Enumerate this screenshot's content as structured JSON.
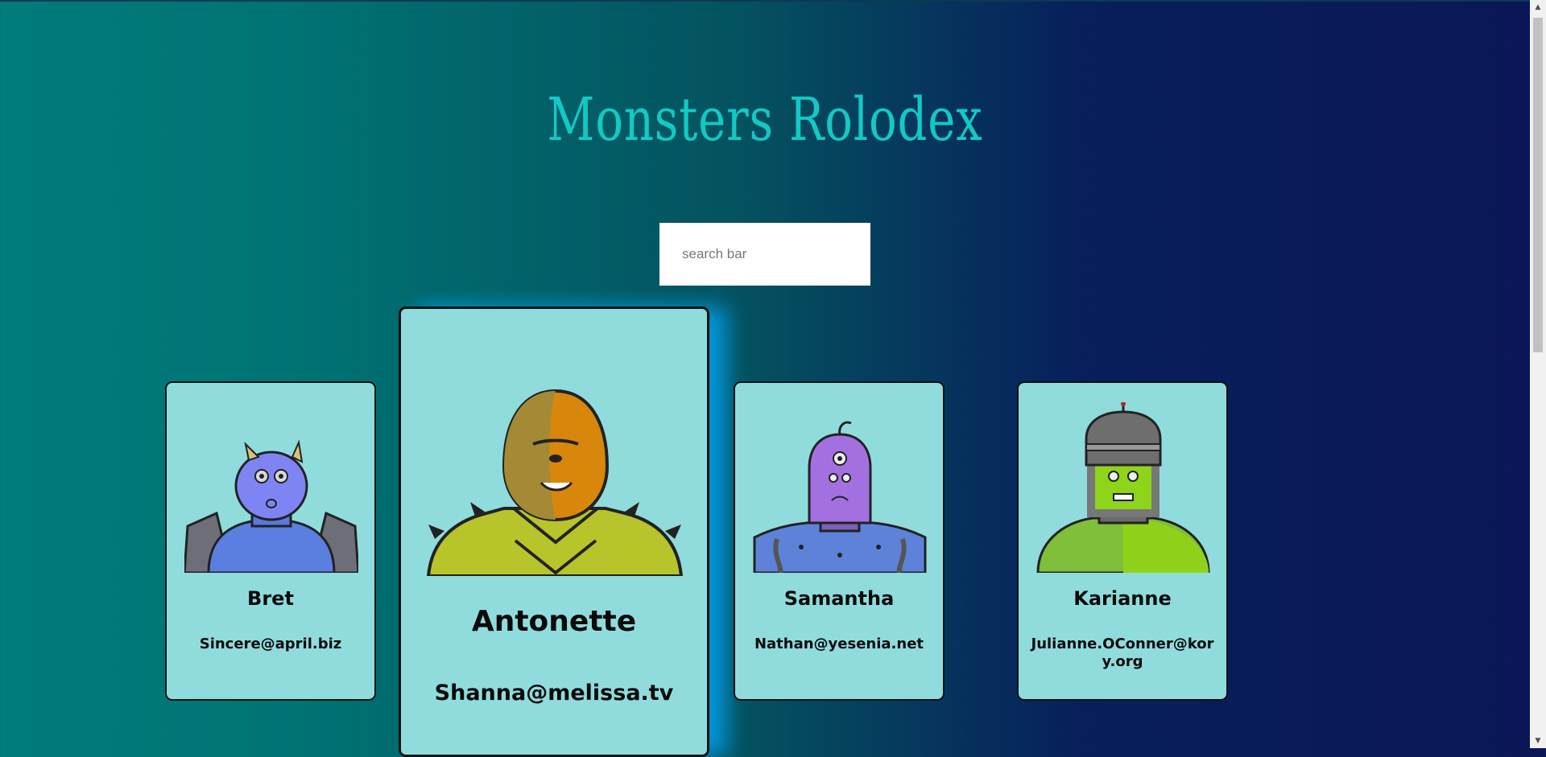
{
  "app": {
    "title": "Monsters Rolodex"
  },
  "search": {
    "placeholder": "search bar"
  },
  "monsters": [
    {
      "name": "Bret",
      "email": "Sincere@april.biz"
    },
    {
      "name": "Antonette",
      "email": "Shanna@melissa.tv"
    },
    {
      "name": "Samantha",
      "email": "Nathan@yesenia.net"
    },
    {
      "name": "Karianne",
      "email": "Julianne.OConner@kory.org"
    }
  ],
  "icons": {
    "avatar_0": "blue-horned-monster-icon",
    "avatar_1": "orange-hooded-monster-icon",
    "avatar_2": "purple-cyclops-robot-monster-icon",
    "avatar_3": "green-helmet-monster-icon",
    "scroll_up": "chevron-up-icon",
    "scroll_down": "chevron-down-icon"
  },
  "colors": {
    "title": "#12c9c4",
    "card": "#90dcdd",
    "featured_glow": "#00aaff"
  }
}
